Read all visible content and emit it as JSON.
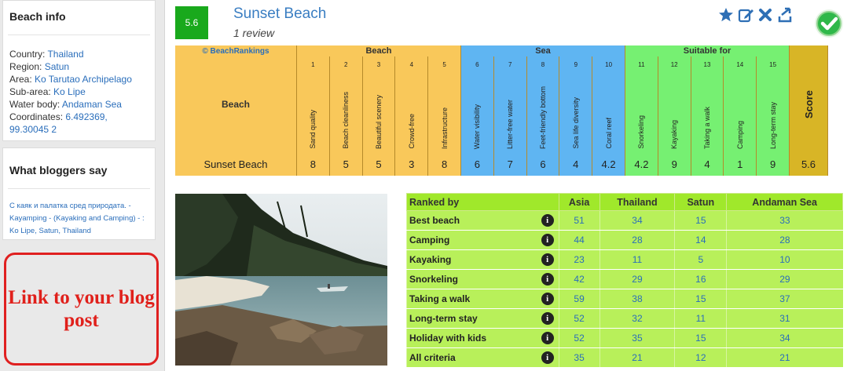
{
  "sidebar": {
    "info_title": "Beach info",
    "info": [
      {
        "label": "Country: ",
        "value": "Thailand"
      },
      {
        "label": "Region: ",
        "value": "Satun"
      },
      {
        "label": "Area: ",
        "value": "Ko Tarutao Archipelago"
      },
      {
        "label": "Sub-area: ",
        "value": "Ko Lipe"
      },
      {
        "label": "Water body: ",
        "value": "Andaman Sea"
      },
      {
        "label": "Coordinates: ",
        "value": "6.492369, 99.30045 2"
      }
    ],
    "bloggers_title": "What bloggers say",
    "blogger_text": "С каяк и палатка сред природата. - Kayamping - (Kayaking and Camping) - : Ko Lipe, Satun, Thailand",
    "link_box_text": "Link to your blog post"
  },
  "header": {
    "score": "5.6",
    "title": "Sunset Beach",
    "reviews": "1 review",
    "tools": [
      "star-icon",
      "edit-icon",
      "close-icon",
      "download-icon"
    ],
    "check_icon": "check-icon"
  },
  "ratings": {
    "copyright": "© BeachRankings",
    "groups": [
      {
        "name": "Beach",
        "color": "#f9c85a"
      },
      {
        "name": "Sea",
        "color": "#5fb5f2"
      },
      {
        "name": "Suitable for",
        "color": "#76f072"
      }
    ],
    "row_header": "Beach",
    "score_header": "Score",
    "beach_name": "Sunset Beach",
    "score": "5.6",
    "criteria": [
      {
        "num": "1",
        "label": "Sand quality",
        "value": "8",
        "group": 0
      },
      {
        "num": "2",
        "label": "Beach cleanliness",
        "value": "5",
        "group": 0
      },
      {
        "num": "3",
        "label": "Beautiful scenery",
        "value": "5",
        "group": 0
      },
      {
        "num": "4",
        "label": "Crowd-free",
        "value": "3",
        "group": 0
      },
      {
        "num": "5",
        "label": "Infrastructure",
        "value": "8",
        "group": 0
      },
      {
        "num": "6",
        "label": "Water visibility",
        "value": "6",
        "group": 1
      },
      {
        "num": "7",
        "label": "Litter-free water",
        "value": "7",
        "group": 1
      },
      {
        "num": "8",
        "label": "Feet-friendly bottom",
        "value": "6",
        "group": 1
      },
      {
        "num": "9",
        "label": "Sea life diversity",
        "value": "4",
        "group": 1
      },
      {
        "num": "10",
        "label": "Coral reef",
        "value": "4.2",
        "group": 1
      },
      {
        "num": "11",
        "label": "Snorkeling",
        "value": "4.2",
        "group": 2
      },
      {
        "num": "12",
        "label": "Kayaking",
        "value": "9",
        "group": 2
      },
      {
        "num": "13",
        "label": "Taking a walk",
        "value": "4",
        "group": 2
      },
      {
        "num": "14",
        "label": "Camping",
        "value": "1",
        "group": 2
      },
      {
        "num": "15",
        "label": "Long-term stay",
        "value": "9",
        "group": 2
      }
    ]
  },
  "photo": {
    "alt": ""
  },
  "rankings": {
    "headers": [
      "Ranked by",
      "Asia",
      "Thailand",
      "Satun",
      "Andaman Sea"
    ],
    "rows": [
      {
        "label": "Best beach",
        "values": [
          "51",
          "34",
          "15",
          "33"
        ]
      },
      {
        "label": "Camping",
        "values": [
          "44",
          "28",
          "14",
          "28"
        ]
      },
      {
        "label": "Kayaking",
        "values": [
          "23",
          "11",
          "5",
          "10"
        ]
      },
      {
        "label": "Snorkeling",
        "values": [
          "42",
          "29",
          "16",
          "29"
        ]
      },
      {
        "label": "Taking a walk",
        "values": [
          "59",
          "38",
          "15",
          "37"
        ]
      },
      {
        "label": "Long-term stay",
        "values": [
          "52",
          "32",
          "11",
          "31"
        ]
      },
      {
        "label": "Holiday with kids",
        "values": [
          "52",
          "35",
          "15",
          "34"
        ]
      },
      {
        "label": "All criteria",
        "values": [
          "35",
          "21",
          "12",
          "21"
        ]
      }
    ]
  }
}
